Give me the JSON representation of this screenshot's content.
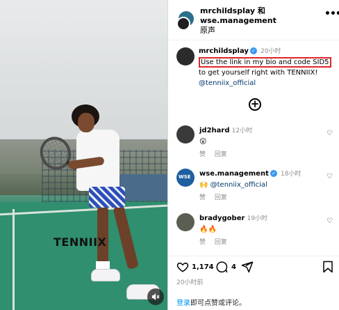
{
  "video": {
    "brand_text": "TENNIIX",
    "mute_icon": "speaker-muted-icon"
  },
  "header": {
    "line1": "mrchildsplay 和",
    "line2": "wse.management",
    "line3": "原声",
    "more_icon": "•••"
  },
  "caption": {
    "username": "mrchildsplay",
    "verified": "✓",
    "time": "20小时",
    "highlighted": "Use the link in my bio and code SID5",
    "text_rest": " to get yourself right with TENNIIX!",
    "mention": "@tenniix_official"
  },
  "add_icon": "+",
  "comments": [
    {
      "username": "jd2hard",
      "time": "12小时",
      "text": "😮",
      "like_label": "赞",
      "reply_label": "回复",
      "verified": ""
    },
    {
      "username": "wse.management",
      "verified": "✓",
      "time": "18小时",
      "text_emoji": "🙌",
      "mention": "@tenniix_official",
      "like_label": "赞",
      "reply_label": "回复"
    },
    {
      "username": "bradygober",
      "time": "19小时",
      "text": "🔥🔥",
      "like_label": "赞",
      "reply_label": "回复",
      "verified": ""
    }
  ],
  "footer": {
    "likes": "1,174",
    "comments": "4",
    "date": "20小时前",
    "login_link": "登录",
    "login_rest": "即可点赞或评论。"
  },
  "colors": {
    "accent": "#0095f6",
    "highlight_box": "#e0252b",
    "verified": "#3897f0"
  }
}
